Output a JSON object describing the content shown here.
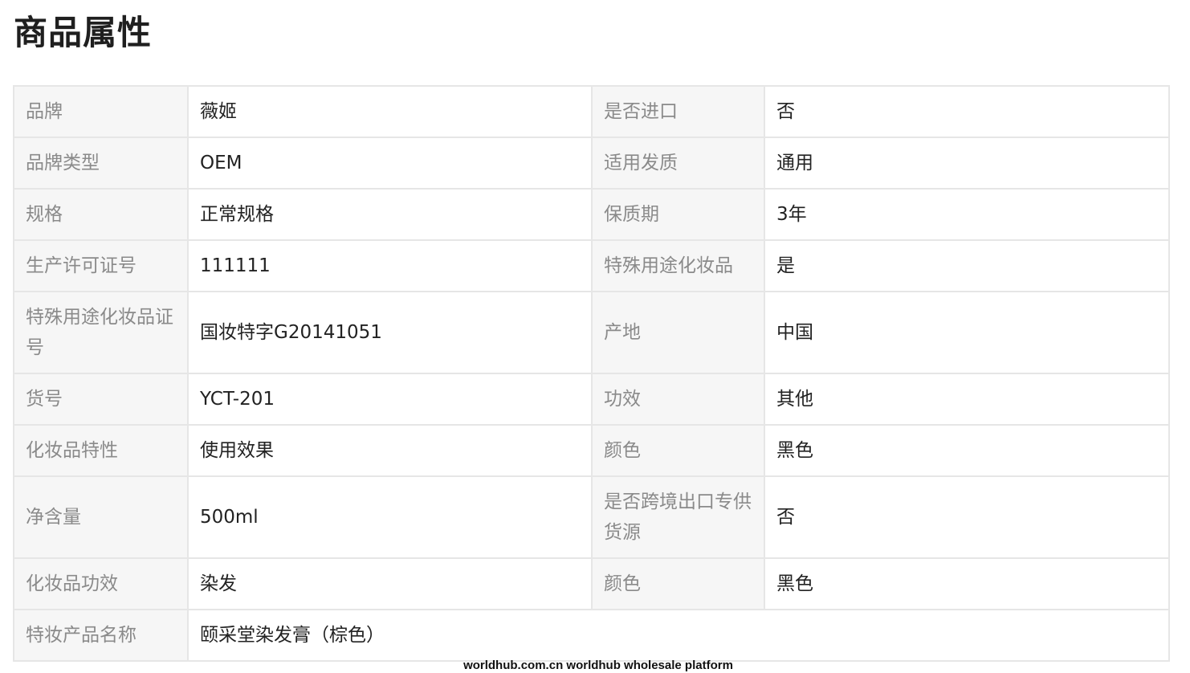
{
  "section_title": "商品属性",
  "attributes": [
    {
      "k1": "品牌",
      "v1": "薇姬",
      "k2": "是否进口",
      "v2": "否"
    },
    {
      "k1": "品牌类型",
      "v1": "OEM",
      "k2": "适用发质",
      "v2": "通用"
    },
    {
      "k1": "规格",
      "v1": "正常规格",
      "k2": "保质期",
      "v2": "3年"
    },
    {
      "k1": "生产许可证号",
      "v1": "111111",
      "k2": "特殊用途化妆品",
      "v2": "是"
    },
    {
      "k1": "特殊用途化妆品证号",
      "v1": "国妆特字G20141051",
      "k2": "产地",
      "v2": "中国"
    },
    {
      "k1": "货号",
      "v1": "YCT-201",
      "k2": "功效",
      "v2": "其他"
    },
    {
      "k1": "化妆品特性",
      "v1": "使用效果",
      "k2": "颜色",
      "v2": "黑色"
    },
    {
      "k1": "净含量",
      "v1": "500ml",
      "k2": "是否跨境出口专供货源",
      "v2": "否"
    },
    {
      "k1": "化妆品功效",
      "v1": "染发",
      "k2": "颜色",
      "v2": "黑色"
    },
    {
      "k1": "特妆产品名称",
      "v1": "颐采堂染发膏（棕色）"
    }
  ],
  "footer_text": "worldhub.com.cn worldhub wholesale platform"
}
